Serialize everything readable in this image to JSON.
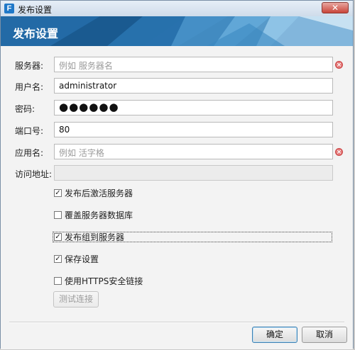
{
  "window": {
    "title": "发布设置",
    "app_icon_letter": "F",
    "close_glyph": "✕"
  },
  "banner": {
    "title": "发布设置"
  },
  "form": {
    "server": {
      "label": "服务器:",
      "placeholder": "例如 服务器名",
      "error_icon": "error-icon"
    },
    "username": {
      "label": "用户名:",
      "value": "administrator"
    },
    "password": {
      "label": "密码:",
      "masked": "●●●●●●"
    },
    "port": {
      "label": "端口号:",
      "value": "80"
    },
    "app_name": {
      "label": "应用名:",
      "placeholder": "例如 活字格",
      "error_icon": "error-icon"
    },
    "access_url": {
      "label": "访问地址:",
      "value": ""
    }
  },
  "options": [
    {
      "label": "发布后激活服务器",
      "checked": true
    },
    {
      "label": "覆盖服务器数据库",
      "checked": false
    },
    {
      "label": "发布组到服务器",
      "checked": true
    },
    {
      "label": "保存设置",
      "checked": true
    },
    {
      "label": "使用HTTPS安全链接",
      "checked": false
    }
  ],
  "buttons": {
    "test_connection": "测试连接",
    "ok": "确定",
    "cancel": "取消"
  },
  "colors": {
    "banner": "#1b5d94",
    "accent": "#1f78c8"
  }
}
